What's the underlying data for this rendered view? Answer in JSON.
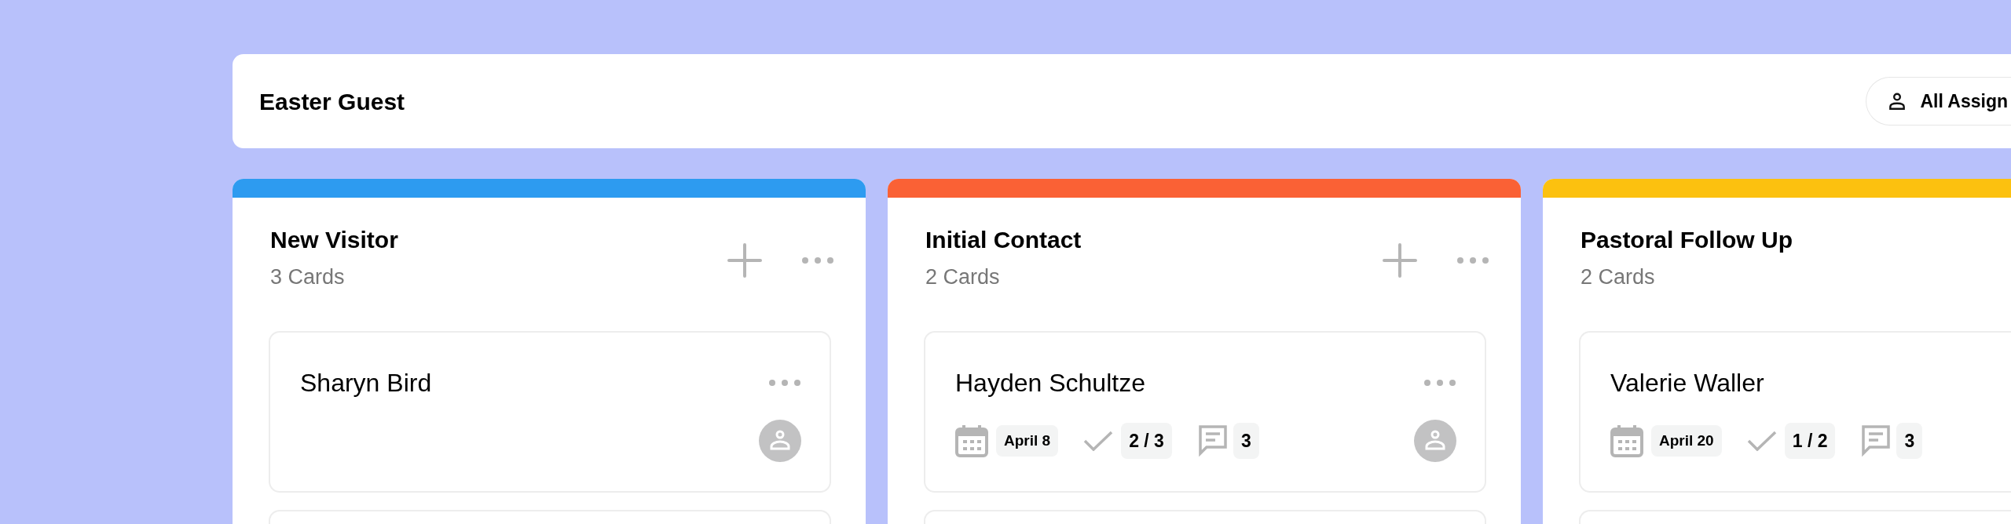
{
  "header": {
    "title": "Easter Guest",
    "filter_button": "All Assign"
  },
  "columns": [
    {
      "title": "New Visitor",
      "count": "3 Cards",
      "color": "#2d9bf0",
      "controls": true,
      "cards": [
        {
          "name": "Sharyn Bird",
          "menu": true,
          "avatar": true
        }
      ]
    },
    {
      "title": "Initial Contact",
      "count": "2 Cards",
      "color": "#fa6135",
      "controls": true,
      "cards": [
        {
          "name": "Hayden Schultze",
          "menu": true,
          "avatar": true,
          "date": "April 8",
          "tasks": "2 / 3",
          "comments": "3"
        }
      ]
    },
    {
      "title": "Pastoral Follow Up",
      "count": "2 Cards",
      "color": "#fcc10f",
      "cards": [
        {
          "name": "Valerie Waller",
          "date": "April 20",
          "tasks": "1 / 2",
          "comments": "3"
        }
      ]
    }
  ]
}
